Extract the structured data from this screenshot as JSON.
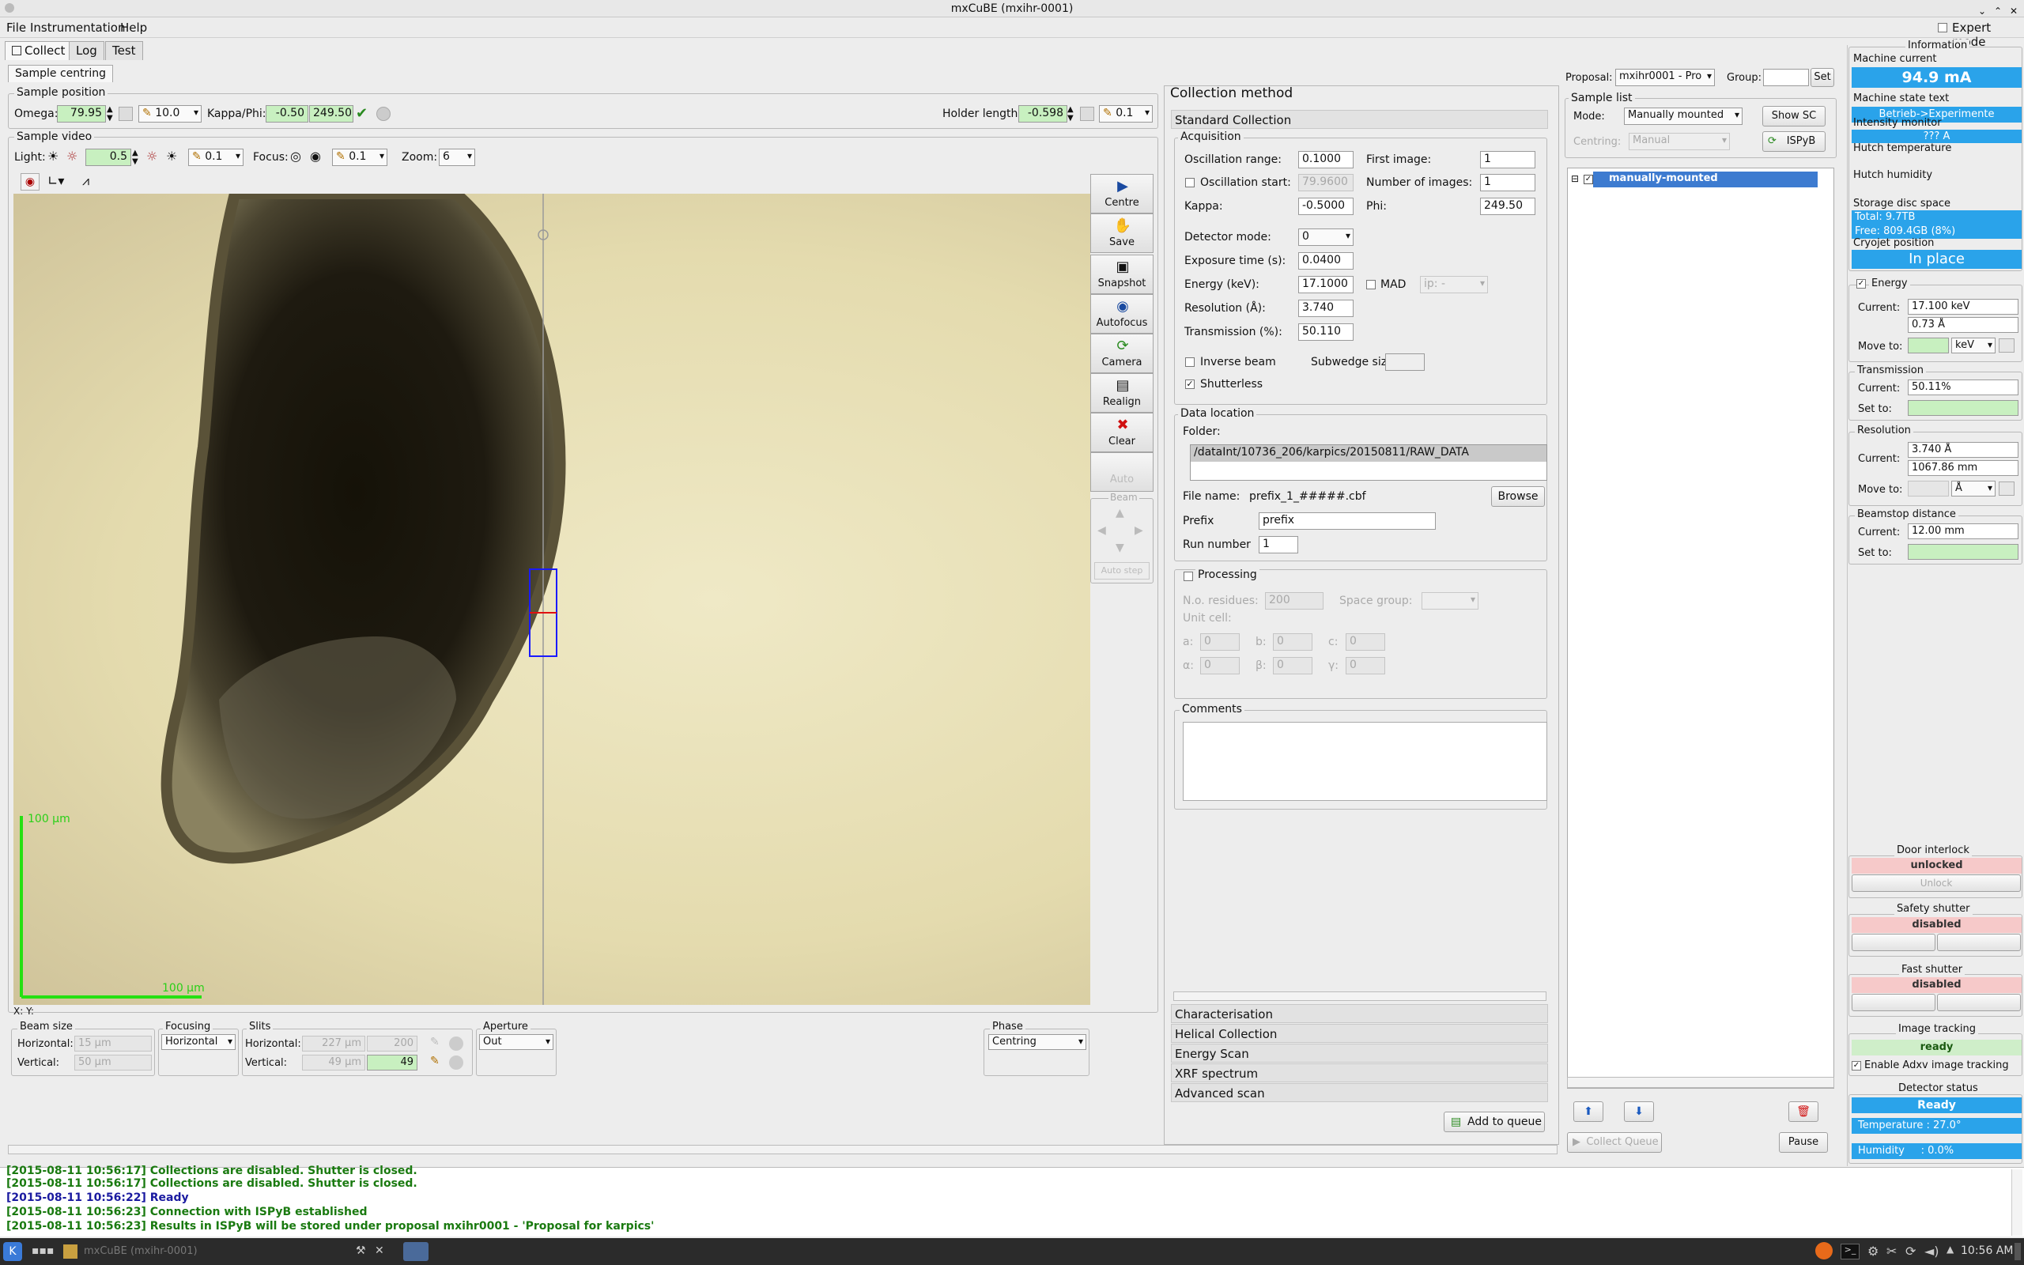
{
  "window": {
    "title": "mxCuBE (mxihr-0001)"
  },
  "menu": {
    "file": "File",
    "instrumentation": "Instrumentation",
    "help": "Help",
    "expert_mode": "Expert mode"
  },
  "tabs": {
    "collect": "Collect",
    "log": "Log",
    "test": "Test"
  },
  "sample_centring": {
    "tab": "Sample centring",
    "sample_position_title": "Sample position",
    "omega_label": "Omega:",
    "omega_value": "79.95",
    "omega_step": "10.0",
    "kappa_phi_label": "Kappa/Phi:",
    "kappa_value": "-0.50",
    "phi_value": "249.50",
    "holder_length_label": "Holder length:",
    "holder_length_value": "-0.598",
    "holder_step": "0.1"
  },
  "sample_video": {
    "title": "Sample video",
    "light_label": "Light:",
    "light_value": "0.5",
    "light_step": "0.1",
    "focus_label": "Focus:",
    "focus_step": "0.1",
    "zoom_label": "Zoom:",
    "zoom_value": "6",
    "scale_label_vertical": "100 µm",
    "scale_label_horizontal": "100 µm",
    "coords": "X: Y:"
  },
  "side_buttons": {
    "centre": "Centre",
    "save": "Save",
    "snapshot": "Snapshot",
    "autofocus": "Autofocus",
    "camera": "Camera",
    "realign": "Realign",
    "clear": "Clear",
    "auto": "Auto",
    "beam": "Beam",
    "autostep": "Auto step"
  },
  "beam_size": {
    "title": "Beam size",
    "horizontal_label": "Horizontal:",
    "horizontal_value": "15 µm",
    "vertical_label": "Vertical:",
    "vertical_value": "50 µm"
  },
  "focusing": {
    "title": "Focusing",
    "value": "Horizontal"
  },
  "slits": {
    "title": "Slits",
    "horizontal_label": "Horizontal:",
    "horizontal_value": "227 µm",
    "horizontal_set": "200",
    "vertical_label": "Vertical:",
    "vertical_value": "49 µm",
    "vertical_set": "49"
  },
  "aperture": {
    "title": "Aperture",
    "value": "Out"
  },
  "phase": {
    "title": "Phase",
    "value": "Centring"
  },
  "collection": {
    "title": "Collection method",
    "standard": "Standard Collection",
    "acquisition": "Acquisition",
    "osc_range_label": "Oscillation range:",
    "osc_range": "0.1000",
    "osc_start_label": "Oscillation start:",
    "osc_start": "79.9600",
    "kappa_label": "Kappa:",
    "kappa": "-0.5000",
    "first_image_label": "First image:",
    "first_image": "1",
    "num_images_label": "Number of images:",
    "num_images": "1",
    "phi_label": "Phi:",
    "phi": "249.50",
    "detector_mode_label": "Detector mode:",
    "detector_mode": "0",
    "exposure_label": "Exposure time (s):",
    "exposure": "0.0400",
    "energy_label": "Energy (keV):",
    "energy": "17.1000",
    "mad_label": "MAD",
    "mad_value": "ip: -",
    "resolution_label": "Resolution (Å):",
    "resolution": "3.740",
    "transmission_label": "Transmission (%):",
    "transmission": "50.110",
    "inverse_beam_label": "Inverse beam",
    "subwedge_label": "Subwedge size:",
    "shutterless_label": "Shutterless",
    "data_location": "Data location",
    "folder_label": "Folder:",
    "folder": "/dataInt/10736_206/karpics/20150811/RAW_DATA",
    "file_name_label": "File name:",
    "file_name": "prefix_1_#####.cbf",
    "browse": "Browse",
    "prefix_label": "Prefix",
    "prefix": "prefix",
    "run_number_label": "Run number",
    "run_number": "1",
    "processing_label": "Processing",
    "residues_label": "N.o. residues:",
    "residues": "200",
    "space_group_label": "Space group:",
    "unit_cell_label": "Unit cell:",
    "cell_a": "a:",
    "cell_b": "b:",
    "cell_c": "c:",
    "cell_alpha": "α:",
    "cell_beta": "β:",
    "cell_gamma": "γ:",
    "cell_val": "0",
    "comments_label": "Comments",
    "characterisation": "Characterisation",
    "helical": "Helical Collection",
    "energy_scan": "Energy Scan",
    "xrf": "XRF spectrum",
    "advanced": "Advanced scan",
    "add_to_queue": "Add to queue"
  },
  "proposal": {
    "label": "Proposal:",
    "value": "mxihr0001 - Pro",
    "group_label": "Group:",
    "set": "Set"
  },
  "sample_list": {
    "title": "Sample list",
    "mode_label": "Mode:",
    "mode_value": "Manually mounted",
    "show_sc": "Show SC",
    "centring_label": "Centring:",
    "centring_value": "Manual",
    "ispyb": "ISPyB",
    "item": "manually-mounted",
    "collect_queue": "Collect Queue",
    "pause": "Pause"
  },
  "info": {
    "title": "Information",
    "machine_current_label": "Machine current",
    "machine_current": "94.9 mA",
    "machine_state_label": "Machine state text",
    "machine_state": "Betrieb->Experimente",
    "intensity_label": "Intensity monitor",
    "intensity": "??? A",
    "hutch_temp_label": "Hutch temperature",
    "hutch_hum_label": "Hutch humidity",
    "storage_label": "Storage disc space",
    "storage_total": "Total: 9.7TB",
    "storage_free": "Free: 809.4GB (8%)",
    "cryojet_label": "Cryojet position",
    "cryojet": "In place"
  },
  "energy": {
    "title": "Energy",
    "current_label": "Current:",
    "current_kev": "17.100 keV",
    "current_a": "0.73 Å",
    "move_label": "Move to:",
    "unit": "keV"
  },
  "transmission": {
    "title": "Transmission",
    "current_label": "Current:",
    "current": "50.11%",
    "set_label": "Set to:"
  },
  "resolution": {
    "title": "Resolution",
    "current_label": "Current:",
    "current_a": "3.740 Å",
    "current_mm": "1067.86 mm",
    "move_label": "Move to:",
    "unit": "Å"
  },
  "beamstop": {
    "title": "Beamstop distance",
    "current_label": "Current:",
    "current": "12.00 mm",
    "set_label": "Set to:"
  },
  "door": {
    "title": "Door interlock",
    "state": "unlocked",
    "button": "Unlock"
  },
  "safety": {
    "title": "Safety shutter",
    "state": "disabled"
  },
  "fast": {
    "title": "Fast shutter",
    "state": "disabled"
  },
  "tracking": {
    "title": "Image tracking",
    "state": "ready",
    "enable_label": "Enable Adxv image tracking"
  },
  "detector": {
    "title": "Detector status",
    "state": "Ready",
    "temperature": "Temperature : 27.0°",
    "humidity": "Humidity     : 0.0%"
  },
  "log": [
    {
      "time": "[2015-08-11 10:56:17]",
      "text": "Collections are disabled. Shutter is closed."
    },
    {
      "time": "[2015-08-11 10:56:17]",
      "text": "Collections are disabled. Shutter is closed."
    },
    {
      "time": "[2015-08-11 10:56:22]",
      "text": "Ready"
    },
    {
      "time": "[2015-08-11 10:56:23]",
      "text": "Connection with ISPyB established"
    },
    {
      "time": "[2015-08-11 10:56:23]",
      "text": "Results in ISPyB will be stored under proposal mxihr0001 - 'Proposal for karpics'"
    }
  ],
  "taskbar": {
    "window_label": "mxCuBE (mxihr-0001)",
    "clock": "10:56 AM"
  },
  "colors": {
    "accent_blue": "#2aa3ea",
    "ok_green": "#cfeec9",
    "warn_pink": "#f6c9c9",
    "field_green": "#c8f0c0",
    "log_green": "#1a7a10",
    "log_blue": "#1a1aa0"
  }
}
